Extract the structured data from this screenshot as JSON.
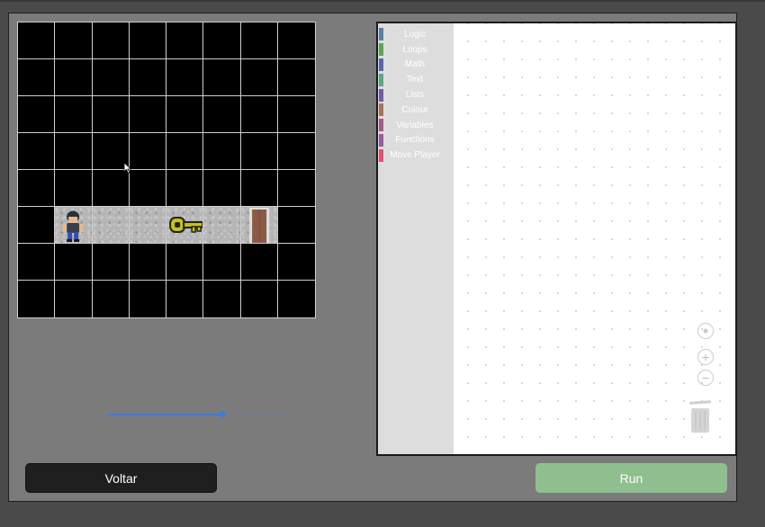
{
  "game": {
    "rows": 8,
    "cols": 8,
    "path_row": 5,
    "player": {
      "row": 5,
      "col": 1,
      "icon": "player-character-icon"
    },
    "key": {
      "row": 5,
      "col": 4,
      "icon": "golden-key-icon"
    },
    "door": {
      "row": 5,
      "col": 6,
      "icon": "wooden-door-icon"
    },
    "floor_cols": [
      1,
      2,
      3,
      4,
      5,
      6
    ]
  },
  "speed_slider": {
    "value_fraction": 0.64
  },
  "buttons": {
    "back_label": "Voltar",
    "run_label": "Run"
  },
  "toolbox": {
    "categories": [
      {
        "label": "Logic",
        "color": "#5b80a5"
      },
      {
        "label": "Loops",
        "color": "#5ba55b"
      },
      {
        "label": "Math",
        "color": "#5b67a5"
      },
      {
        "label": "Text",
        "color": "#5ba58c"
      },
      {
        "label": "Lists",
        "color": "#745ba5"
      },
      {
        "label": "Colour",
        "color": "#a5745b"
      },
      {
        "label": "Variables",
        "color": "#a55b80"
      },
      {
        "label": "Functions",
        "color": "#995ba5"
      },
      {
        "label": "Move Player",
        "color": "#e0507a"
      }
    ]
  },
  "workspace_controls": {
    "recenter_icon": "crosshair-icon",
    "zoom_in_icon": "plus-icon",
    "zoom_out_icon": "minus-icon",
    "trash_icon": "trash-can-icon"
  },
  "colors": {
    "panel_bg": "#7b7b7b",
    "slider_accent": "#3b7be0",
    "run_button": "#8fbf8f",
    "back_button": "#1f1f1f"
  }
}
